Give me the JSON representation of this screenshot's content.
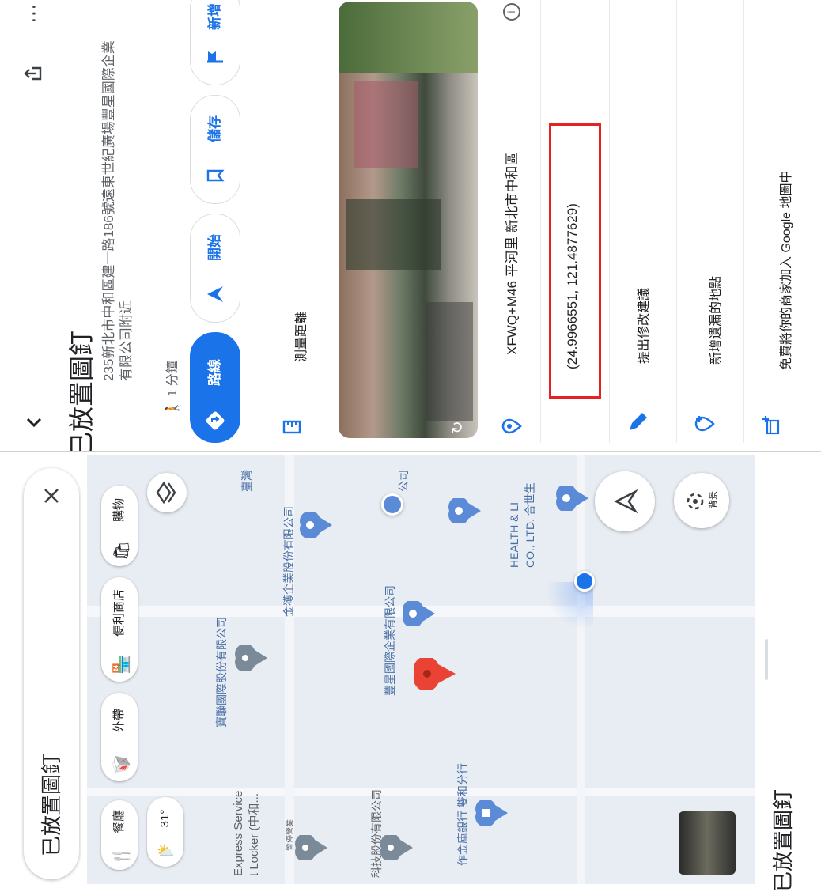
{
  "detail": {
    "title": "已放置圖釘",
    "address": "235新北市中和區建一路186號遠東世紀廣場豐星國際企業有限公司附近",
    "walk_time": "1 分鐘",
    "actions": {
      "directions": "路線",
      "start": "開始",
      "save": "儲存",
      "add": "新增"
    },
    "measure_label": "測量距離",
    "plus_code": "XFWQ+M46 平河里 新北市中和區",
    "coordinates": "(24.9966551, 121.4877629)",
    "suggest_edit": "提出修改建議",
    "add_missing_place": "新增遺漏的地點",
    "add_business": "免費將你的商家加入 Google 地圖中"
  },
  "map": {
    "search_value": "已放置圖釘",
    "chips": {
      "restaurants": "餐廳",
      "takeout": "外帶",
      "convenience": "便利商店",
      "shopping": "購物"
    },
    "weather": "31°",
    "labels": {
      "express_line1": "Express Service",
      "express_line2": "t Locker (中和...",
      "closed": "暫停營業",
      "company1": "寶聯國際股份有限公司",
      "company2": "金獲企業股份有限公司",
      "company3": "豐星國際企業有限公司",
      "company4": "科技股份有限公司",
      "bank": "作金庫銀行 雙和分行",
      "health_line1": "HEALTH & LI",
      "health_line2": "CO., LTD. 合世生",
      "corner1": "臺灣",
      "corner2": "公司"
    },
    "layers_label": "背景",
    "bottom_title": "已放置圖釘"
  },
  "colors": {
    "accent": "#1a73e8",
    "pin_red": "#ea4335",
    "highlight": "#e52222"
  }
}
